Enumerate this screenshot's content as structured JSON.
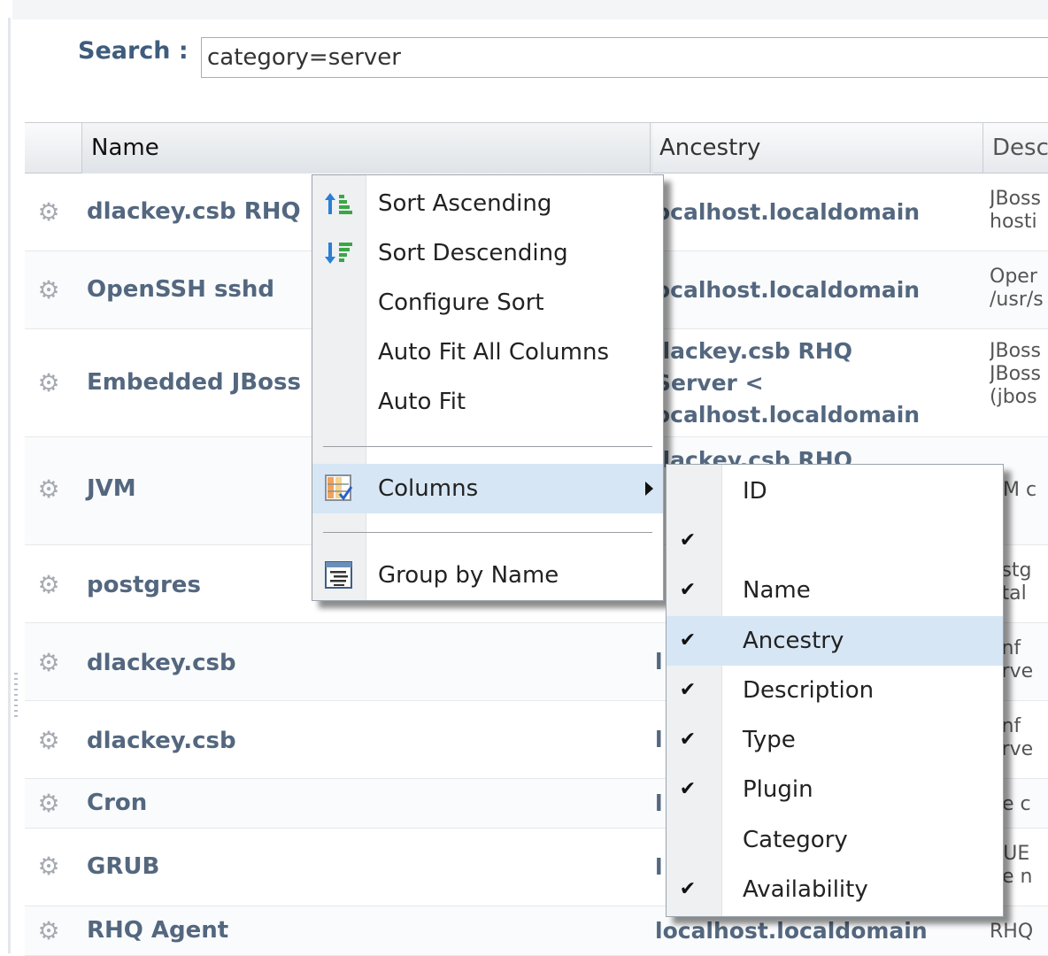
{
  "search": {
    "label": "Search :",
    "value": "category=server"
  },
  "columns": {
    "name": "Name",
    "ancestry": "Ancestry",
    "description": "Desc"
  },
  "rows": [
    {
      "name": "dlackey.csb RHQ",
      "ancestry": "ocalhost.localdomain",
      "description": "JBoss\nhosti"
    },
    {
      "name": "OpenSSH sshd",
      "ancestry": "ocalhost.localdomain",
      "description": "Oper\n/usr/s"
    },
    {
      "name": "Embedded JBoss",
      "ancestry": "llackey.csb RHQ\nServer <\nocalhost.localdomain",
      "description": "JBoss\nJBoss\n(jbos"
    },
    {
      "name": "JVM",
      "ancestry": "llackey.csb RHQ",
      "description": "VM c"
    },
    {
      "name": "postgres",
      "ancestry": "",
      "description": "ostg\natal"
    },
    {
      "name": "dlackey.csb",
      "ancestry": "l",
      "description": "onf\nerve"
    },
    {
      "name": "dlackey.csb",
      "ancestry": "l",
      "description": "onf\nerve"
    },
    {
      "name": "Cron",
      "ancestry": "l",
      "description": "he c"
    },
    {
      "name": "GRUB",
      "ancestry": "l",
      "description": "RUE\nhe n"
    },
    {
      "name": "RHQ Agent",
      "ancestry": "localhost.localdomain",
      "description": "RHQ"
    }
  ],
  "context_menu": {
    "items": [
      {
        "label": "Sort Ascending",
        "icon": "sort-ascending-icon"
      },
      {
        "label": "Sort Descending",
        "icon": "sort-descending-icon"
      },
      {
        "label": "Configure Sort",
        "icon": ""
      },
      {
        "label": "Auto Fit All Columns",
        "icon": ""
      },
      {
        "label": "Auto Fit",
        "icon": ""
      },
      {
        "label": "Columns",
        "icon": "columns-icon",
        "highlighted": true,
        "submenu": true
      },
      {
        "label": "Group by Name",
        "icon": "group-icon"
      }
    ]
  },
  "columns_submenu": {
    "items": [
      {
        "label": "ID",
        "checked": false
      },
      {
        "label": "",
        "checked": true
      },
      {
        "label": "Name",
        "checked": true
      },
      {
        "label": "Ancestry",
        "checked": true,
        "highlighted": true
      },
      {
        "label": "Description",
        "checked": true
      },
      {
        "label": "Type",
        "checked": true
      },
      {
        "label": "Plugin",
        "checked": true
      },
      {
        "label": "Category",
        "checked": false
      },
      {
        "label": "Availability",
        "checked": true
      }
    ],
    "check_glyph": "✔"
  },
  "colors": {
    "link_text": "#53677f",
    "search_label": "#3f5c7d",
    "highlight": "#d7e6f4"
  }
}
